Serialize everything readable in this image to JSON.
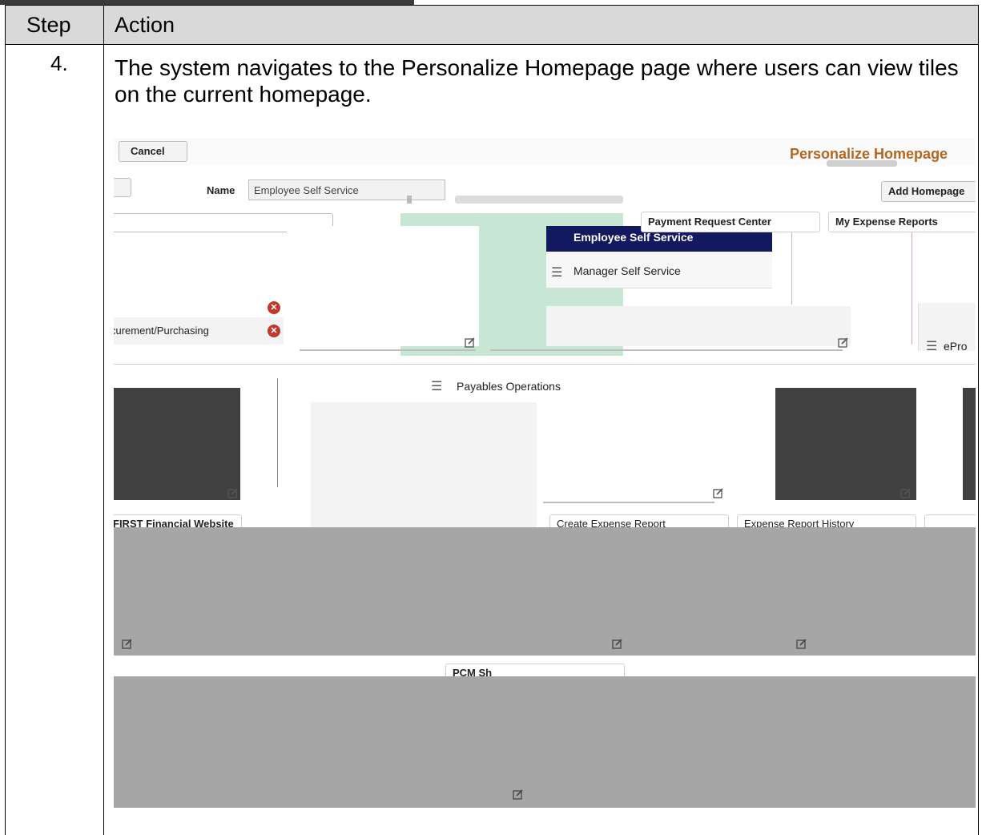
{
  "table": {
    "headers": {
      "step": "Step",
      "action": "Action"
    },
    "rows": [
      {
        "step": "4.",
        "action": "The system navigates to the Personalize Homepage page where users can view tiles on the current homepage."
      }
    ]
  },
  "screenshot": {
    "cancel_label": "Cancel",
    "page_title": "Personalize Homepage",
    "name_label": "Name",
    "name_value": "Employee Self Service",
    "add_homepage_label": "Add Homepage",
    "list_items": [
      "curement/Purchasing"
    ],
    "dropdown": {
      "selected": "Employee Self Service",
      "options": [
        "Manager Self Service"
      ]
    },
    "tiles": {
      "payment_request_center": "Payment Request Center",
      "my_expense_reports": "My Expense Reports",
      "payables_operations": "Payables Operations",
      "eprocurement": "ePro",
      "first_financial_website": "FIRST Financial Website",
      "create_expense_report": "Create Expense Report",
      "expense_report_history": "Expense Report History",
      "pcm_short": "PCM Sh"
    },
    "colors": {
      "title": "#b5651d",
      "dropdown_header": "#13195e",
      "mint": "#c8e6d4",
      "gray_block": "#a6a6a6",
      "dark_block": "#404040",
      "remove_icon": "#c0392b"
    }
  }
}
